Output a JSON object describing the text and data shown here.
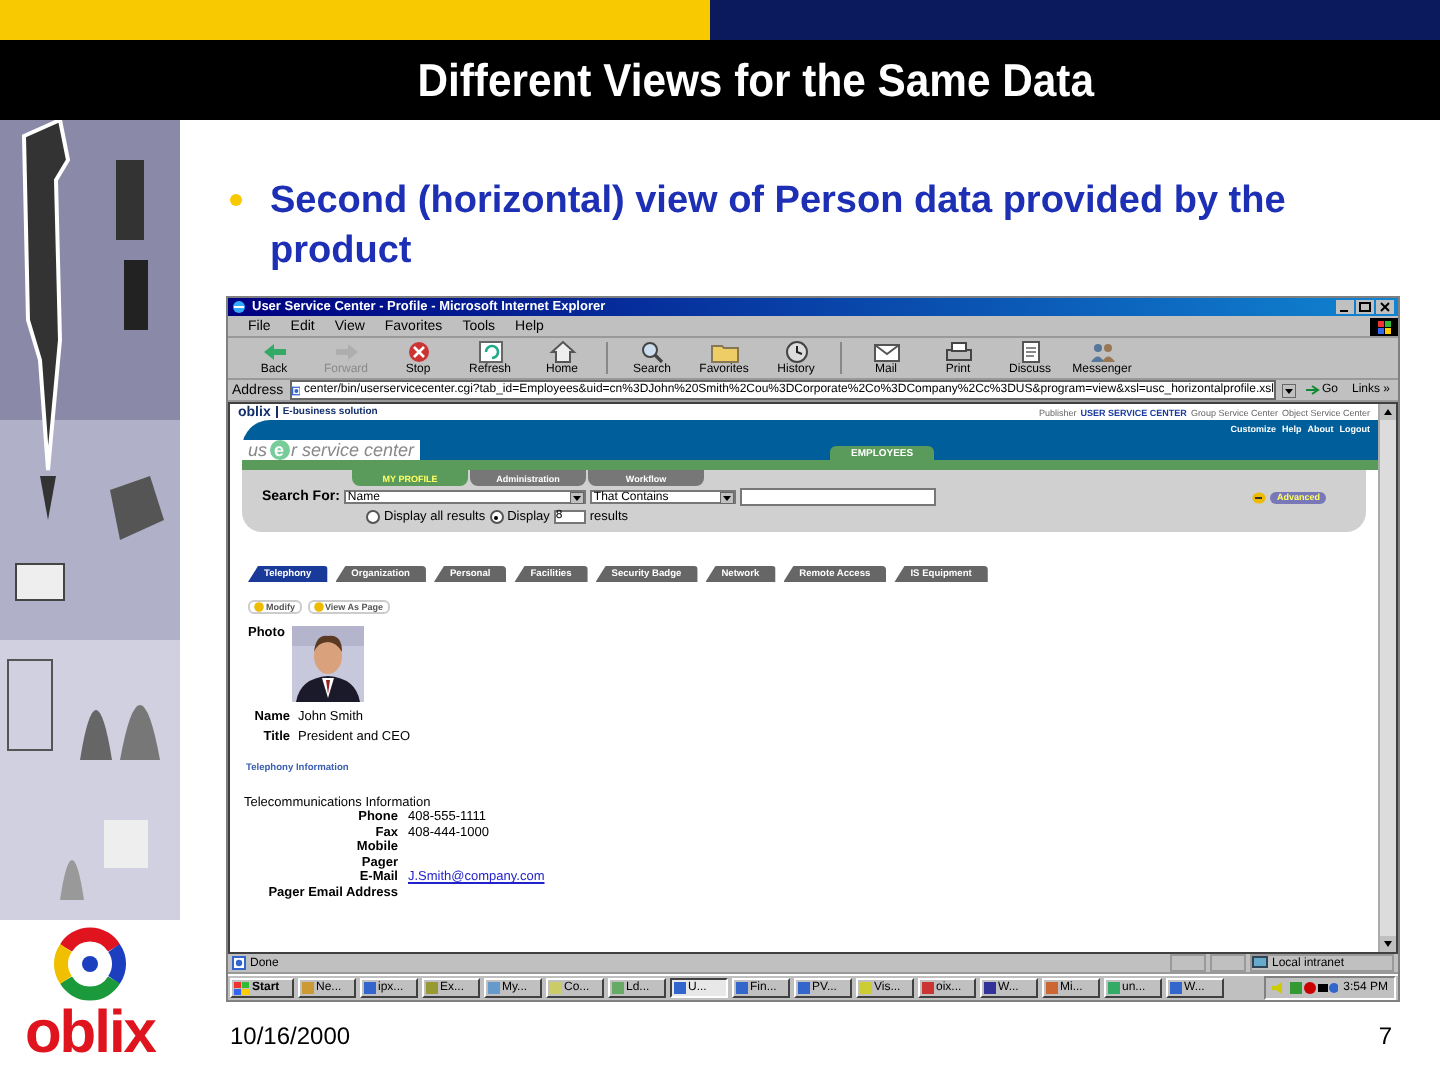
{
  "slide": {
    "title": "Different Views for the Same Data",
    "bullet": "Second (horizontal) view of Person data provided by the product",
    "logo": "oblix",
    "date": "10/16/2000",
    "page": "7"
  },
  "browser": {
    "title": "User Service Center - Profile - Microsoft Internet Explorer",
    "menu": [
      "File",
      "Edit",
      "View",
      "Favorites",
      "Tools",
      "Help"
    ],
    "toolbar": [
      {
        "label": "Back",
        "disabled": false
      },
      {
        "label": "Forward",
        "disabled": true
      },
      {
        "label": "Stop",
        "disabled": false
      },
      {
        "label": "Refresh",
        "disabled": false
      },
      {
        "label": "Home",
        "disabled": false
      },
      {
        "label": "Search",
        "disabled": false
      },
      {
        "label": "Favorites",
        "disabled": false
      },
      {
        "label": "History",
        "disabled": false
      },
      {
        "label": "Mail",
        "disabled": false
      },
      {
        "label": "Print",
        "disabled": false
      },
      {
        "label": "Discuss",
        "disabled": false
      },
      {
        "label": "Messenger",
        "disabled": false
      }
    ],
    "address_label": "Address",
    "address": "center/bin/userservicecenter.cgi?tab_id=Employees&uid=cn%3DJohn%20Smith%2Cou%3DCorporate%2Co%3DCompany%2Cc%3DUS&program=view&xsl=usc_horizontalprofile.xsl",
    "go": "Go",
    "links": "Links »",
    "app": {
      "brand": "oblix",
      "brand_sub": "E-business solution",
      "top_links": [
        {
          "label": "Publisher",
          "selected": false
        },
        {
          "label": "USER SERVICE CENTER",
          "selected": true
        },
        {
          "label": "Group Service Center",
          "selected": false
        },
        {
          "label": "Object Service Center",
          "selected": false
        }
      ],
      "util_links": [
        "Customize",
        "Help",
        "About",
        "Logout"
      ],
      "logo_parts": [
        "us",
        "e",
        "r service center"
      ],
      "main_tab": "EMPLOYEES",
      "sub_tabs": [
        {
          "label": "MY PROFILE",
          "selected": true
        },
        {
          "label": "Administration",
          "selected": false
        },
        {
          "label": "Workflow",
          "selected": false
        }
      ],
      "search_label": "Search For:",
      "search_attribute": "Name",
      "search_operator": "That Contains",
      "advanced": "Advanced",
      "display_options": [
        {
          "label": "Display all results",
          "selected": false
        },
        {
          "label": "Display",
          "selected": true
        }
      ],
      "display_count": "8",
      "results_label": "results",
      "profile_tabs": [
        {
          "label": "Telephony",
          "selected": true
        },
        {
          "label": "Organization",
          "selected": false
        },
        {
          "label": "Personal",
          "selected": false
        },
        {
          "label": "Facilities",
          "selected": false
        },
        {
          "label": "Security Badge",
          "selected": false
        },
        {
          "label": "Network",
          "selected": false
        },
        {
          "label": "Remote Access",
          "selected": false
        },
        {
          "label": "IS Equipment",
          "selected": false
        }
      ],
      "actions": [
        "Modify",
        "View As Page"
      ],
      "photo_label": "Photo",
      "fields": [
        {
          "label": "Name",
          "value": "John Smith"
        },
        {
          "label": "Title",
          "value": "President and CEO"
        }
      ],
      "section_heading": "Telephony Information",
      "section_caption": "Telecommunications Information",
      "phone_fields": [
        {
          "label": "Phone",
          "value": "408-555-1111",
          "kind": "text"
        },
        {
          "label": "Fax",
          "value": "408-444-1000",
          "kind": "text"
        },
        {
          "label": "Mobile"
        },
        {
          "label": "Pager"
        },
        {
          "label": "E-Mail",
          "value": "J.Smith@company.com",
          "kind": "link"
        },
        {
          "label": "Pager Email Address"
        }
      ]
    },
    "status": {
      "text": "Done",
      "zone": "Local intranet"
    },
    "taskbar": {
      "start": "Start",
      "items": [
        {
          "label": "Ne...",
          "selected": false
        },
        {
          "label": "ipx...",
          "selected": false
        },
        {
          "label": "Ex...",
          "selected": false
        },
        {
          "label": "My...",
          "selected": false
        },
        {
          "label": "Co...",
          "selected": false
        },
        {
          "label": "Ld...",
          "selected": false
        },
        {
          "label": "U...",
          "selected": true
        },
        {
          "label": "Fin...",
          "selected": false
        },
        {
          "label": "PV...",
          "selected": false
        },
        {
          "label": "Vis...",
          "selected": false
        },
        {
          "label": "oix...",
          "selected": false
        },
        {
          "label": "W...",
          "selected": false
        },
        {
          "label": "Mi...",
          "selected": false
        },
        {
          "label": "un...",
          "selected": false
        },
        {
          "label": "W...",
          "selected": false
        }
      ],
      "clock": "3:54 PM"
    }
  }
}
